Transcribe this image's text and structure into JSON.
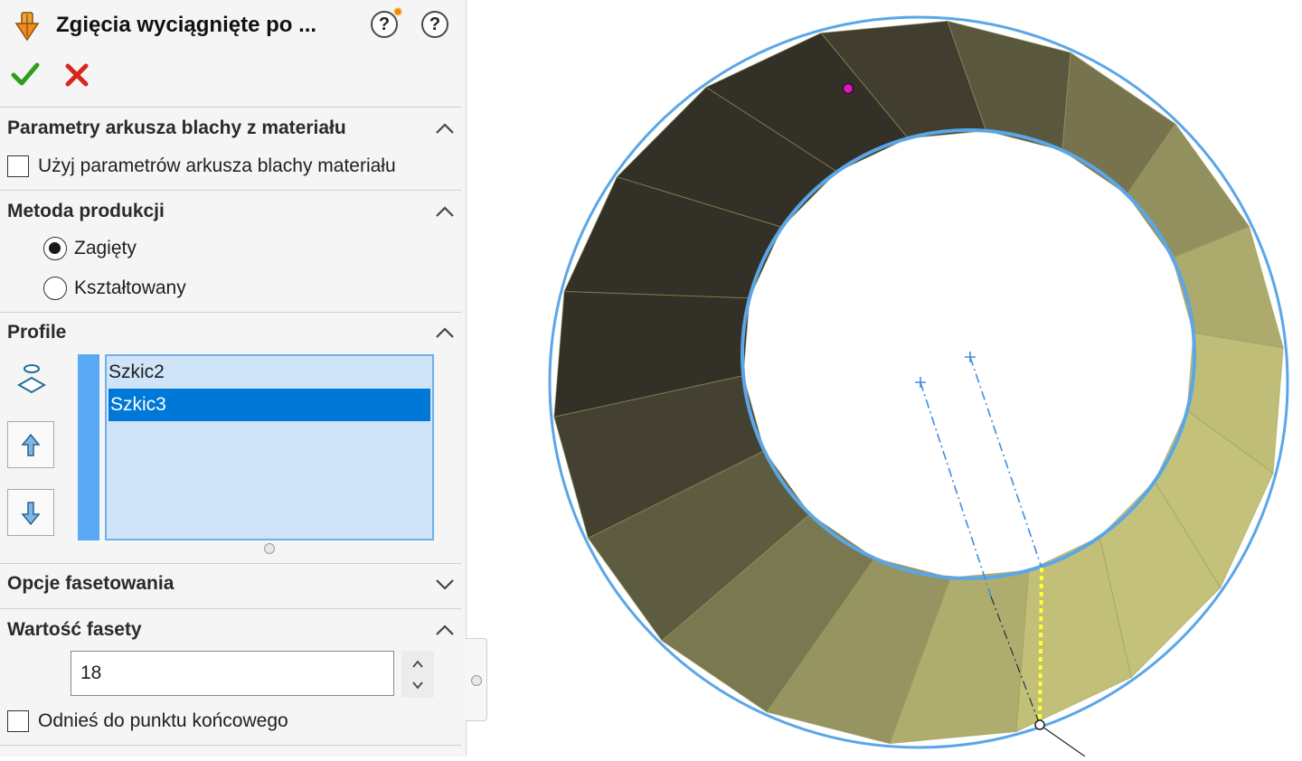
{
  "panel": {
    "title": "Zgięcia wyciągnięte po ...",
    "help_label": "?",
    "context_help_label": "?",
    "ok_icon": "checkmark-icon",
    "cancel_icon": "x-icon",
    "accent_ok": "#2e9e1a",
    "accent_cancel": "#d9261c"
  },
  "sections": {
    "sheet_params": {
      "title": "Parametry arkusza blachy z materiału",
      "checkbox_label": "Użyj parametrów arkusza blachy materiału",
      "checked": false
    },
    "method": {
      "title": "Metoda produkcji",
      "options": [
        {
          "label": "Zagięty",
          "selected": true
        },
        {
          "label": "Kształtowany",
          "selected": false
        }
      ]
    },
    "profile": {
      "title": "Profile",
      "items": [
        {
          "label": "Szkic2",
          "selected": false
        },
        {
          "label": "Szkic3",
          "selected": true
        }
      ],
      "highlight_color": "#0078d7",
      "strip_color": "#5aa9f5"
    },
    "facet_options": {
      "title": "Opcje fasetowania",
      "expanded": false
    },
    "facet_value": {
      "title": "Wartość fasety",
      "value": "18",
      "checkbox_label": "Odnieś do punktu końcowego",
      "checked": false
    }
  },
  "viewport": {
    "model": "faceted-ring",
    "facet_count": 18,
    "light_color": "#c4c27a",
    "dark_color": "#333028",
    "edge_color": "#5aa6e8",
    "seam_color": "#ffff33"
  }
}
